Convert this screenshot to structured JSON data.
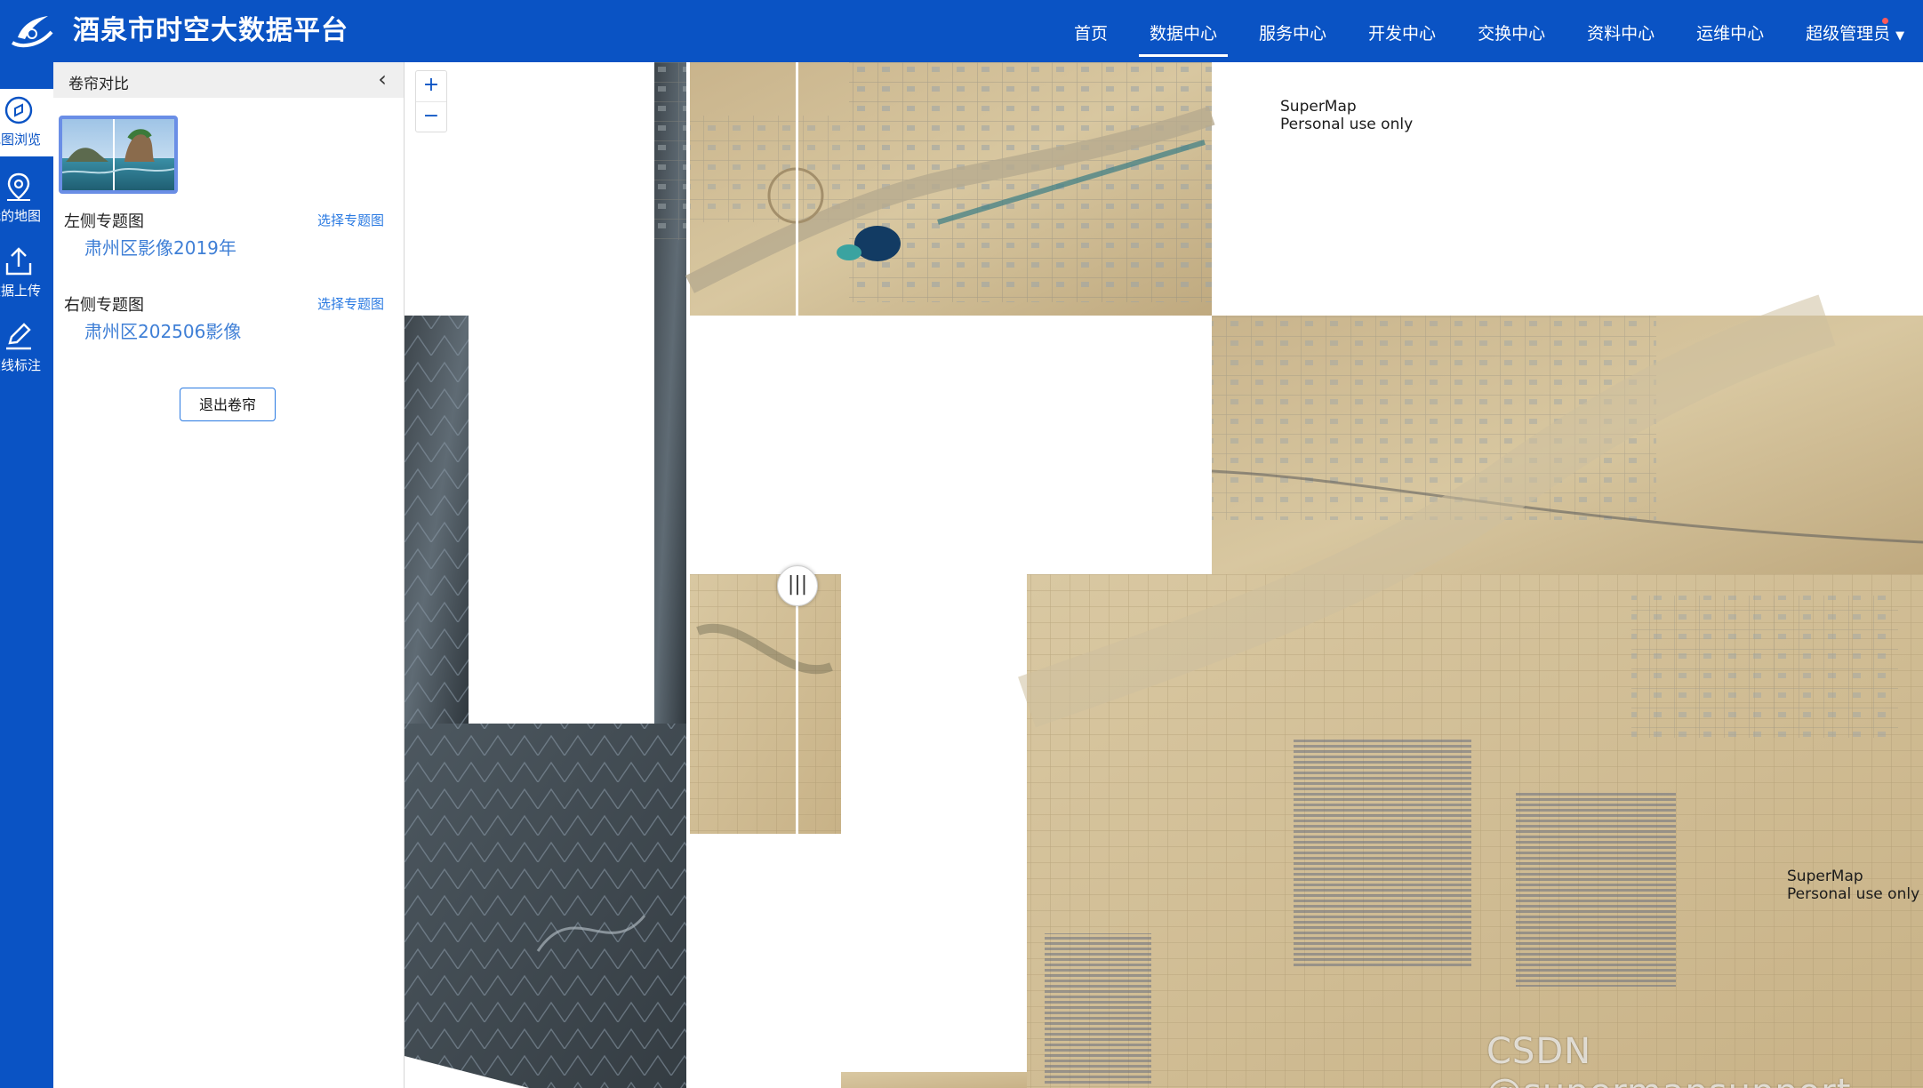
{
  "header": {
    "title": "酒泉市时空大数据平台",
    "nav": [
      {
        "label": "首页",
        "active": false
      },
      {
        "label": "数据中心",
        "active": true
      },
      {
        "label": "服务中心",
        "active": false
      },
      {
        "label": "开发中心",
        "active": false
      },
      {
        "label": "交换中心",
        "active": false
      },
      {
        "label": "资料中心",
        "active": false
      },
      {
        "label": "运维中心",
        "active": false
      }
    ],
    "user": "超级管理员"
  },
  "rail": {
    "items": [
      {
        "label": "地图浏览",
        "icon": "compass-icon",
        "active": true
      },
      {
        "label": "我的地图",
        "icon": "map-pin-icon",
        "active": false
      },
      {
        "label": "数据上传",
        "icon": "upload-icon",
        "active": false
      },
      {
        "label": "在线标注",
        "icon": "edit-pen-icon",
        "active": false
      }
    ]
  },
  "panel": {
    "title": "卷帘对比",
    "left": {
      "label": "左侧专题图",
      "link": "选择专题图",
      "value": "肃州区影像2019年"
    },
    "right": {
      "label": "右侧专题图",
      "link": "选择专题图",
      "value": "肃州区202506影像"
    },
    "exit_label": "退出卷帘"
  },
  "map": {
    "zoom_in": "+",
    "zoom_out": "−",
    "watermark_line1": "SuperMap",
    "watermark_line2": "Personal use only",
    "handle": "|||",
    "credit": "CSDN @supermapsupport"
  },
  "colors": {
    "brand": "#0a53c4",
    "link": "#2a7ae2",
    "value": "#3f7fd6"
  }
}
